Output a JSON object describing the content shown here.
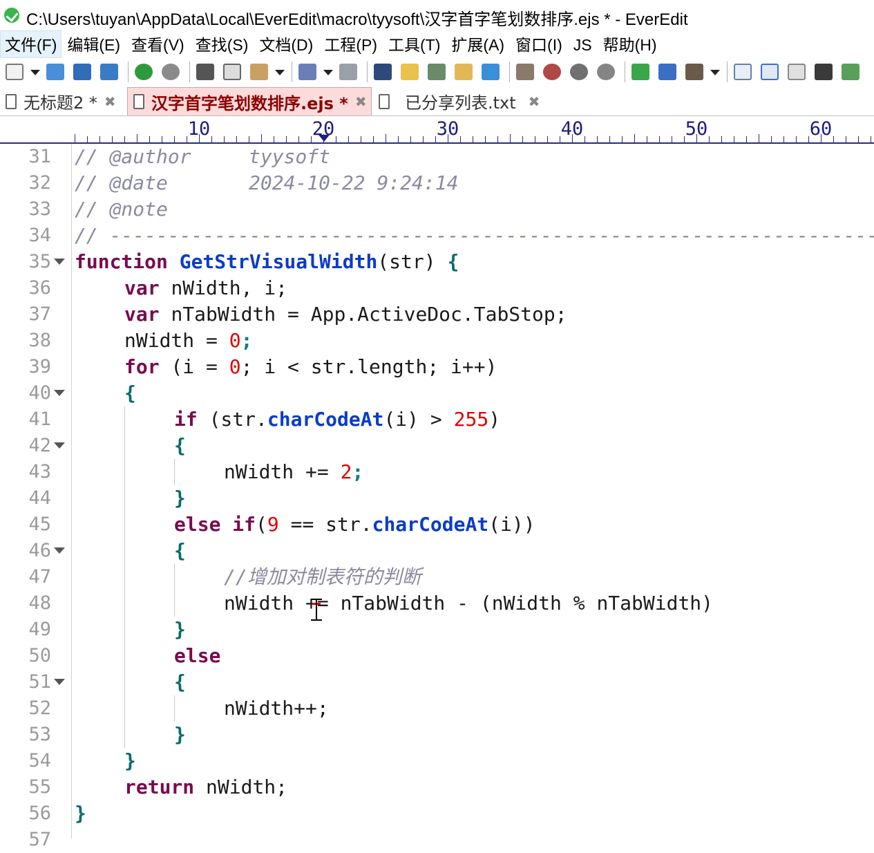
{
  "window": {
    "title": "C:\\Users\\tuyan\\AppData\\Local\\EverEdit\\macro\\tyysoft\\汉字首字笔划数排序.ejs * - EverEdit"
  },
  "menu": [
    "文件(F)",
    "编辑(E)",
    "查看(V)",
    "查找(S)",
    "文档(D)",
    "工程(P)",
    "工具(T)",
    "扩展(A)",
    "窗口(I)",
    "JS",
    "帮助(H)"
  ],
  "tabs": [
    {
      "label": "无标题2 *",
      "close": "✖"
    },
    {
      "label": "汉字首字笔划数排序.ejs *",
      "close": "✖"
    },
    {
      "label": "已分享列表.txt",
      "close": "✖"
    }
  ],
  "ruler": [
    "10",
    "20",
    "30",
    "40",
    "50",
    "60"
  ],
  "line_numbers": [
    "31",
    "32",
    "33",
    "34",
    "35",
    "36",
    "37",
    "38",
    "39",
    "40",
    "41",
    "42",
    "43",
    "44",
    "45",
    "46",
    "47",
    "48",
    "49",
    "50",
    "51",
    "52",
    "53",
    "54",
    "55",
    "56",
    "57"
  ],
  "code": {
    "l31a": "// @author",
    "l31b": "tyysoft",
    "l32a": "// @date",
    "l32b": "2024-10-22 9:24:14",
    "l33": "// @note",
    "l34": "// -------------------------------------------------------------------------------",
    "kw_function": "function",
    "fn_name": "GetStrVisualWidth",
    "params": "(str)",
    "open_brace": "{",
    "kw_var": "var",
    "l36_rest": "nWidth, i;",
    "l37_rest": "nTabWidth = App.ActiveDoc.TabStop;",
    "l38a": "nWidth = ",
    "n0": "0",
    "semi": ";",
    "kw_for": "for",
    "l39a": " (i = ",
    "l39b": "; i < str.length; i++)",
    "kw_if": "if",
    "l41a": " (str.",
    "fn_charCodeAt": "charCodeAt",
    "l41b": "(i) > ",
    "n255": "255",
    "close_paren": ")",
    "l43a": "nWidth += ",
    "n2": "2",
    "close_brace": "}",
    "kw_else": "else",
    "l45_if": "if",
    "l45a": "(",
    "n9": "9",
    "l45b": " == str.",
    "l45c": "(i))",
    "l47": "//增加对制表符的判断",
    "l48": "nWidth += nTabWidth - (nWidth % nTabWidth)",
    "l52": "nWidth++;",
    "kw_return": "return",
    "l55_rest": " nWidth;"
  },
  "colors": {
    "keyword": "#7a0a4f",
    "function": "#0a3cc8",
    "number": "#e00000",
    "comment": "#8a8aa0",
    "active_tab": "#fcdbdb"
  }
}
